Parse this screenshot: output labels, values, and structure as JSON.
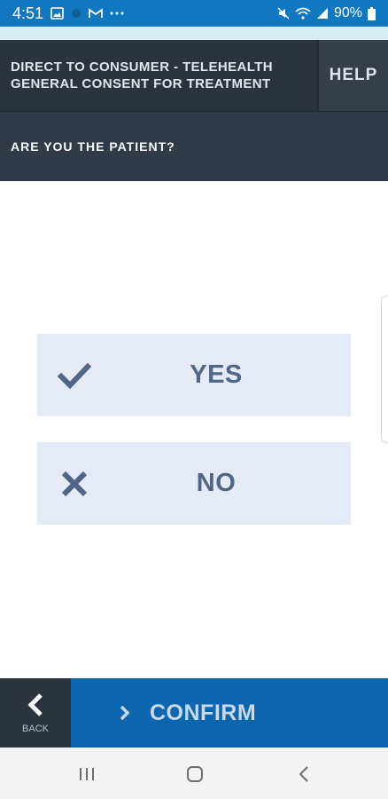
{
  "status_bar": {
    "time": "4:51",
    "battery": "90%",
    "left_icons": [
      "gallery-icon",
      "circle-icon",
      "gmail-icon",
      "more-dots-icon"
    ],
    "right_icons": [
      "mute-icon",
      "wifi-icon",
      "signal-icon",
      "battery-icon"
    ],
    "color": "#1177bf"
  },
  "header": {
    "title_line1": "DIRECT TO CONSUMER - TELEHEALTH",
    "title_line2": "GENERAL CONSENT FOR TREATMENT",
    "help_label": "HELP"
  },
  "question": {
    "text": "ARE YOU THE PATIENT?"
  },
  "options": [
    {
      "label": "YES",
      "icon": "checkmark-icon"
    },
    {
      "label": "NO",
      "icon": "x-icon"
    }
  ],
  "footer": {
    "back_label": "BACK",
    "confirm_label": "CONFIRM",
    "confirm_color": "#0d65ad"
  },
  "nav_bar": {
    "buttons": [
      "recents-icon",
      "home-icon",
      "back-nav-icon"
    ]
  }
}
